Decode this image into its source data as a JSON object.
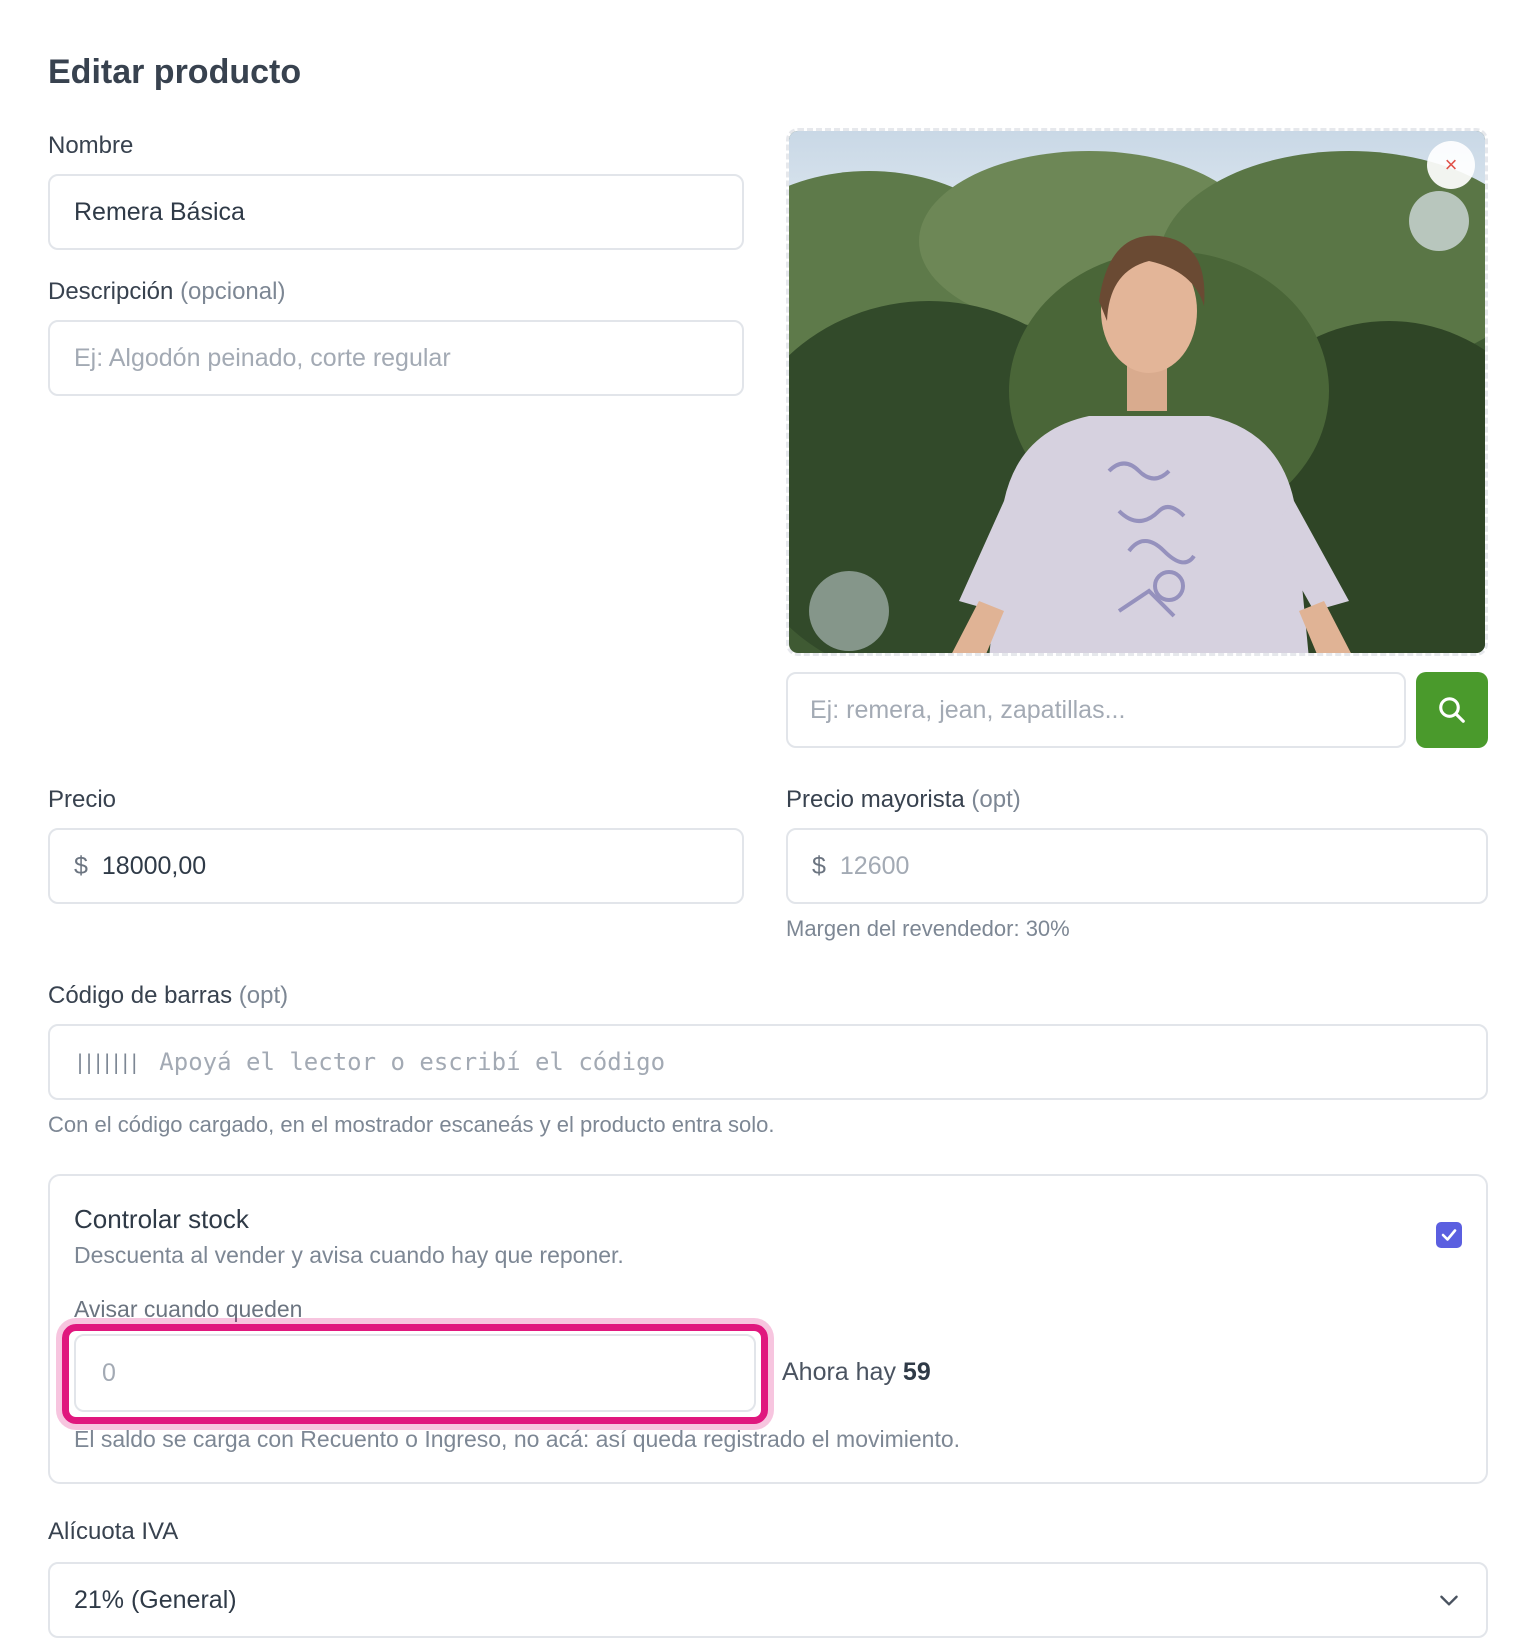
{
  "page": {
    "title": "Editar producto"
  },
  "nombre": {
    "label": "Nombre",
    "value": "Remera Básica"
  },
  "descripcion": {
    "label": "Descripción",
    "optional": "(opcional)",
    "placeholder": "Ej: Algodón peinado, corte regular"
  },
  "image": {
    "search_placeholder": "Ej: remera, jean, zapatillas...",
    "remove_symbol": "×"
  },
  "precio": {
    "label": "Precio",
    "currency": "$",
    "value": "18000,00"
  },
  "precio_mayorista": {
    "label": "Precio mayorista",
    "optional": "(opt)",
    "currency": "$",
    "placeholder": "12600",
    "hint": "Margen del revendedor: 30%"
  },
  "codigo_barras": {
    "label": "Código de barras",
    "optional": "(opt)",
    "icon": "|||||||",
    "placeholder": "Apoyá el lector o escribí el código",
    "hint": "Con el código cargado, en el mostrador escaneás y el producto entra solo."
  },
  "stock": {
    "title": "Controlar stock",
    "subtitle": "Descuenta al vender y avisa cuando hay que reponer.",
    "checked": true,
    "threshold_label": "Avisar cuando queden",
    "threshold_placeholder": "0",
    "now_prefix": "Ahora hay",
    "now_value": "59",
    "hint": "El saldo se carga con Recuento o Ingreso, no acá: así queda registrado el movimiento."
  },
  "iva": {
    "label": "Alícuota IVA",
    "selected": "21% (General)"
  },
  "colors": {
    "accent_green": "#4a9a2c",
    "checkbox": "#5b5fe0",
    "focus_ring": "#e0177e"
  }
}
